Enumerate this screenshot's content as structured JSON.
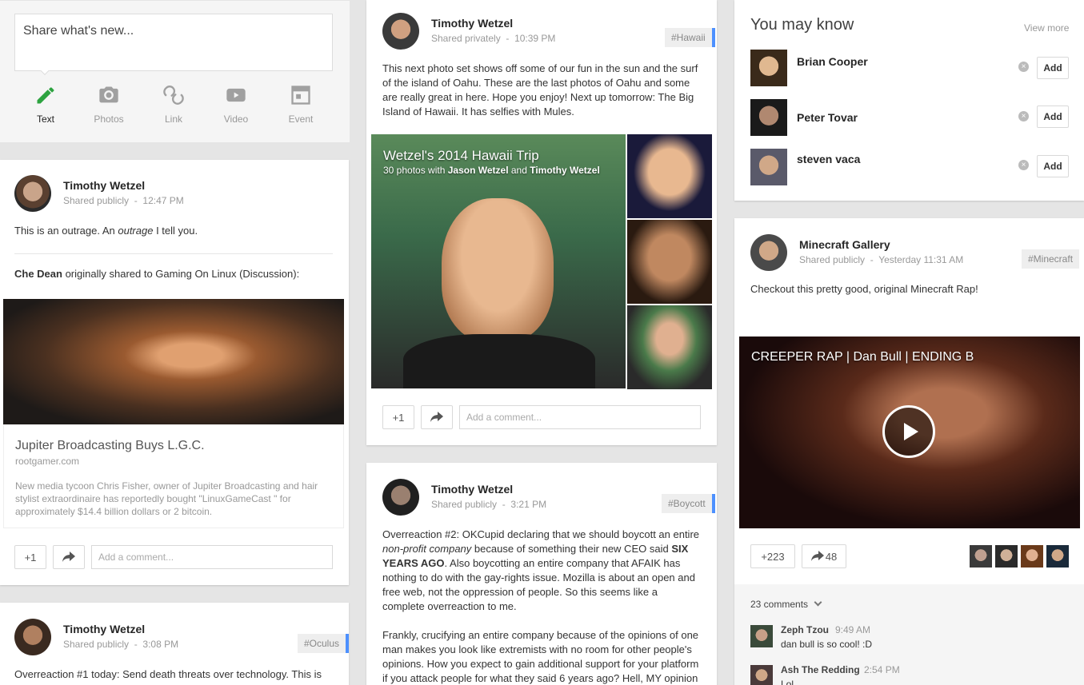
{
  "share_box": {
    "placeholder": "Share what's new...",
    "actions": [
      {
        "label": "Text"
      },
      {
        "label": "Photos"
      },
      {
        "label": "Link"
      },
      {
        "label": "Video"
      },
      {
        "label": "Event"
      }
    ]
  },
  "post1": {
    "author": "Timothy Wetzel",
    "visibility": "Shared publicly",
    "time": "12:47 PM",
    "text_a": "This is an outrage. An ",
    "text_em": "outrage",
    "text_b": " I tell you.",
    "reshare_name": "Che Dean",
    "reshare_text": " originally shared to Gaming On Linux (Discussion):",
    "link_title": "Jupiter Broadcasting Buys L.G.C.",
    "link_domain": "rootgamer.com",
    "link_desc": "New media tycoon Chris Fisher, owner of Jupiter Broadcasting and hair stylist extraordinaire has reportedly bought \"LinuxGameCast \" for approximately $14.4 billion dollars or 2 bitcoin.",
    "plus_one": "+1",
    "comment_placeholder": "Add a comment..."
  },
  "post2": {
    "author": "Timothy Wetzel",
    "visibility": "Shared publicly",
    "time": "3:08 PM",
    "tag": "#Oculus",
    "text": "Overreaction #1 today: Send death threats over technology. This is"
  },
  "post3": {
    "author": "Timothy Wetzel",
    "visibility": "Shared privately",
    "time": "10:39 PM",
    "tag": "#Hawaii",
    "text": "This next photo set shows off some of our fun in the sun and the surf of the island of Oahu. These are the last photos of Oahu and some are really great in here. Hope you enjoy! Next up tomorrow: The Big Island of Hawaii. It has selfies with Mules.",
    "album_title": "Wetzel's 2014 Hawaii Trip",
    "album_sub_a": "30 photos with ",
    "album_person_1": "Jason Wetzel",
    "album_and": " and ",
    "album_person_2": "Timothy Wetzel",
    "plus_one": "+1",
    "comment_placeholder": "Add a comment..."
  },
  "post4": {
    "author": "Timothy Wetzel",
    "visibility": "Shared publicly",
    "time": "3:21 PM",
    "tag": "#Boycott",
    "p1_a": "Overreaction #2: OKCupid declaring that we should boycott an entire ",
    "p1_em": "non-profit company",
    "p1_b": " because of something their new CEO said ",
    "p1_strong": "SIX YEARS AGO",
    "p1_c": ". Also boycotting an entire company that AFAIK has nothing to do with the gay-rights issue. Mozilla is about an open and free web, not the oppression of people. So this seems like a complete overreaction to me.",
    "p2": "Frankly, crucifying an entire company because of the opinions of one man makes you look like extremists with no room for other people's opinions. How you expect to gain additional support for your platform if you attack people for what they said 6 years ago? Hell, MY opinion"
  },
  "you_may_know": {
    "title": "You may know",
    "view_more": "View more",
    "people": [
      {
        "name": "Brian Cooper",
        "add": "Add"
      },
      {
        "name": "Peter Tovar",
        "add": "Add"
      },
      {
        "name": "steven vaca",
        "add": "Add"
      }
    ]
  },
  "post5": {
    "author": "Minecraft Gallery",
    "visibility": "Shared publicly",
    "time": "Yesterday 11:31 AM",
    "tag": "#Minecraft",
    "text": "Checkout this pretty good, original Minecraft Rap!",
    "video_title": "CREEPER RAP | Dan Bull | ENDING B",
    "plus_count": "+223",
    "share_count": "48",
    "comments_count": "23 comments",
    "comments": [
      {
        "name": "Zeph Tzou",
        "time": "9:49 AM",
        "text": "dan bull is so cool! :D"
      },
      {
        "name": "Ash The Redding",
        "time": "2:54 PM",
        "text": "Lol"
      }
    ]
  }
}
